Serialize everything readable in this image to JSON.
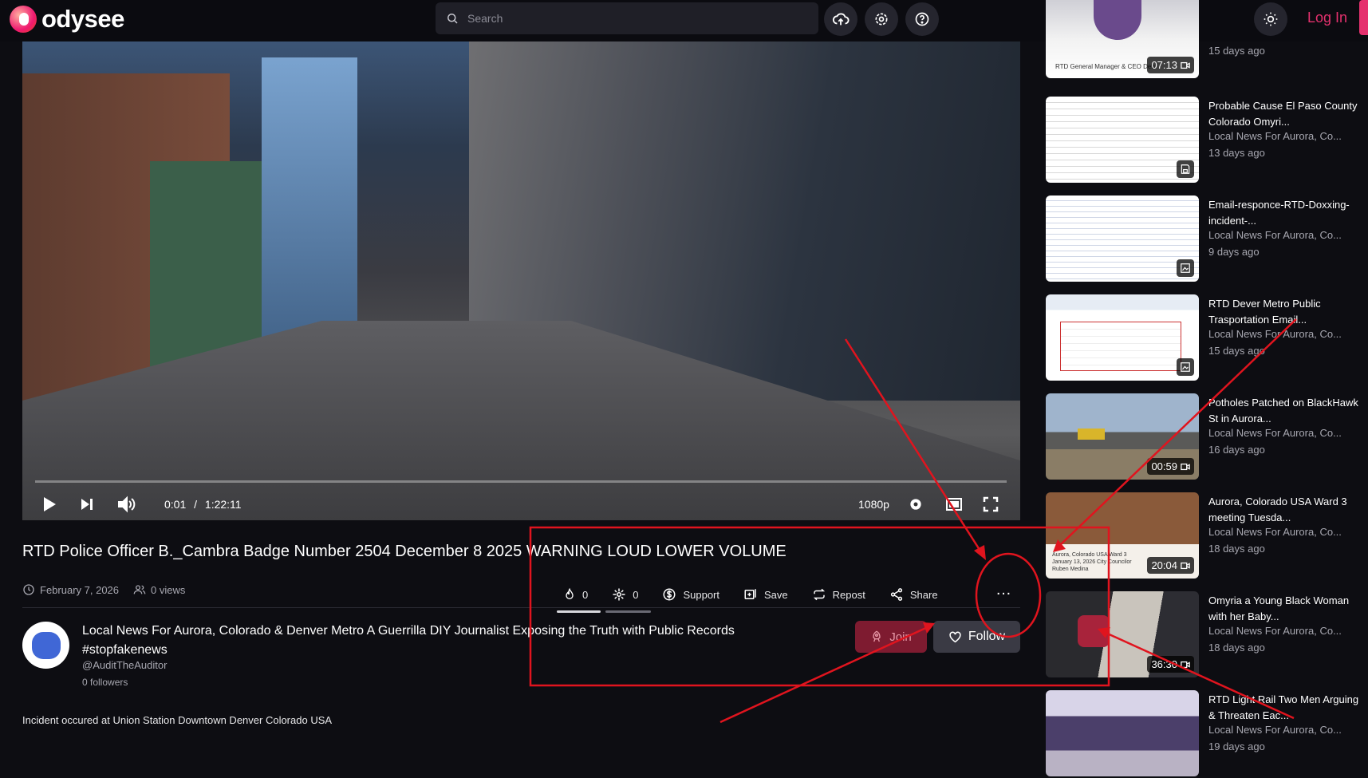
{
  "header": {
    "logo_text": "odysee",
    "search_placeholder": "Search",
    "login_label": "Log In",
    "icons": [
      "upload-icon",
      "settings-icon",
      "help-icon",
      "theme-icon"
    ]
  },
  "player": {
    "current_time": "0:01",
    "separator": "/",
    "duration": "1:22:11",
    "quality": "1080p",
    "progress": 0.0002
  },
  "video": {
    "title": "RTD Police Officer B._Cambra Badge Number 2504 December 8 2025 WARNING LOUD LOWER VOLUME",
    "date": "February 7, 2026",
    "views": "0 views",
    "fires": "0",
    "slimes": "0",
    "support_label": "Support",
    "save_label": "Save",
    "repost_label": "Repost",
    "share_label": "Share",
    "more_label": "…",
    "description": "Incident occured at Union Station Downtown Denver Colorado USA"
  },
  "channel": {
    "name": "Local News For Aurora, Colorado & Denver Metro A Guerrilla DIY Journalist Exposing the Truth with Public Records #stopfakenews",
    "handle": "@AuditTheAuditor",
    "followers": "0 followers",
    "join_label": "Join",
    "follow_label": "Follow"
  },
  "sidebar": {
    "items": [
      {
        "title": "",
        "channel": "",
        "age": "15 days ago",
        "duration": "07:13",
        "badge": "video",
        "thumb_caption": "RTD General Manager & CEO Deb"
      },
      {
        "title": "Probable Cause El Paso County Colorado Omyri...",
        "channel": "Local News For Aurora, Co...",
        "age": "13 days ago",
        "badge": "document"
      },
      {
        "title": "Email-responce-RTD-Doxxing-incident-...",
        "channel": "Local News For Aurora, Co...",
        "age": "9 days ago",
        "badge": "image"
      },
      {
        "title": "RTD Dever Metro Public Trasportation Email...",
        "channel": "Local News For Aurora, Co...",
        "age": "15 days ago",
        "badge": "image"
      },
      {
        "title": "Potholes Patched on BlackHawk St in Aurora...",
        "channel": "Local News For Aurora, Co...",
        "age": "16 days ago",
        "duration": "00:59",
        "badge": "video"
      },
      {
        "title": "Aurora, Colorado USA Ward 3 meeting Tuesda...",
        "channel": "Local News For Aurora, Co...",
        "age": "18 days ago",
        "duration": "20:04",
        "badge": "video",
        "thumb_caption": "Aurora, Colorado USA Ward 3 January 13, 2026 City Councilor Ruben Medina"
      },
      {
        "title": "Omyria a Young Black Woman with her Baby...",
        "channel": "Local News For Aurora, Co...",
        "age": "18 days ago",
        "duration": "36:30",
        "badge": "video"
      },
      {
        "title": "RTD Light Rail Two Men Arguing & Threaten Eac...",
        "channel": "Local News For Aurora, Co...",
        "age": "19 days ago",
        "badge": "video"
      }
    ]
  },
  "colors": {
    "accent": "#e5316e",
    "annotation": "#e0141e",
    "background": "#0d0d12"
  }
}
